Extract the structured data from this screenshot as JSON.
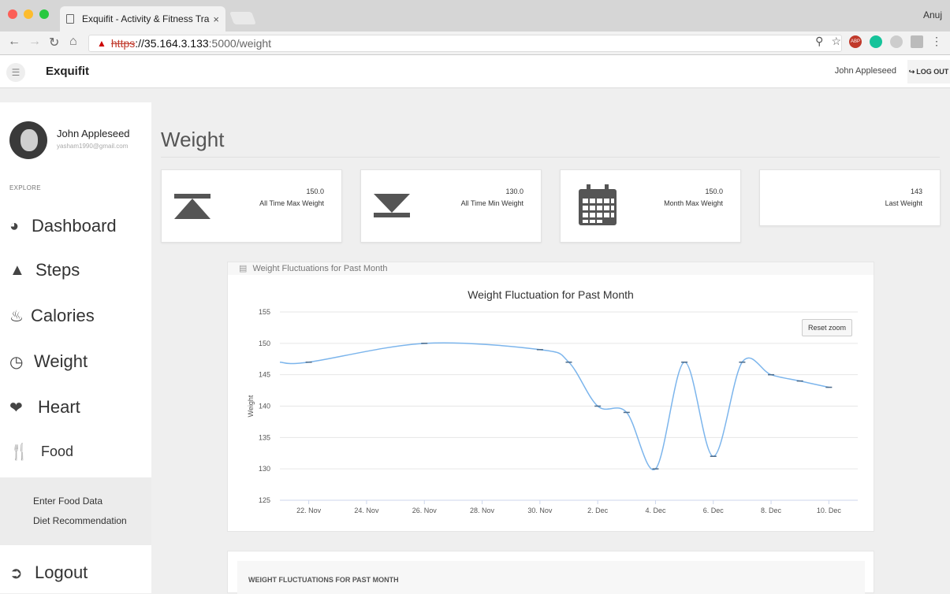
{
  "browser": {
    "tab_title": "Exquifit - Activity & Fitness Tra",
    "tab_close": "×",
    "profile": "Anuj",
    "url_proto": "https",
    "url_host": "://35.164.3.133",
    "url_path": ":5000/weight",
    "ext_abp": "ABP"
  },
  "appbar": {
    "brand": "Exquifit",
    "user": "John Appleseed",
    "logout": "LOG OUT"
  },
  "sidebar": {
    "name": "John Appleseed",
    "email": "yasham1990@gmail.com",
    "section": "EXPLORE",
    "items": [
      {
        "label": "Dashboard",
        "icon": "gauge-icon"
      },
      {
        "label": "Steps",
        "icon": "road-icon"
      },
      {
        "label": "Calories",
        "icon": "flame-icon"
      },
      {
        "label": "Weight",
        "icon": "scale-icon"
      },
      {
        "label": "Heart",
        "icon": "heart-icon"
      },
      {
        "label": "Food",
        "icon": "utensils-icon"
      }
    ],
    "submenu": [
      "Enter Food Data",
      "Diet Recommendation"
    ],
    "logout": "Logout"
  },
  "page": {
    "title": "Weight",
    "stats": [
      {
        "value": "150.0",
        "label": "All Time Max Weight",
        "icon": "arrow-up-max-icon"
      },
      {
        "value": "130.0",
        "label": "All Time Min Weight",
        "icon": "arrow-down-min-icon"
      },
      {
        "value": "150.0",
        "label": "Month Max Weight",
        "icon": "calendar-icon"
      },
      {
        "value": "143",
        "label": "Last Weight",
        "icon": ""
      }
    ],
    "panel_title": "Weight Fluctuations for Past Month",
    "reset_zoom": "Reset zoom",
    "table_title": "WEIGHT FLUCTUATIONS FOR PAST MONTH"
  },
  "chart_data": {
    "type": "line",
    "title": "Weight Fluctuation for Past Month",
    "xlabel": "",
    "ylabel": "Weight",
    "ylim": [
      125,
      155
    ],
    "yticks": [
      125,
      130,
      135,
      140,
      145,
      150,
      155
    ],
    "xticks": [
      "22. Nov",
      "24. Nov",
      "26. Nov",
      "28. Nov",
      "30. Nov",
      "2. Dec",
      "4. Dec",
      "6. Dec",
      "8. Dec",
      "10. Dec"
    ],
    "grid": true,
    "smooth": true,
    "color": "#7cb5ec",
    "points": [
      {
        "x": "2017-11-22",
        "y": 147
      },
      {
        "x": "2017-11-26",
        "y": 150
      },
      {
        "x": "2017-11-30",
        "y": 149
      },
      {
        "x": "2017-12-01",
        "y": 147
      },
      {
        "x": "2017-12-02",
        "y": 140
      },
      {
        "x": "2017-12-03",
        "y": 139
      },
      {
        "x": "2017-12-04",
        "y": 130
      },
      {
        "x": "2017-12-05",
        "y": 147
      },
      {
        "x": "2017-12-06",
        "y": 132
      },
      {
        "x": "2017-12-07",
        "y": 147
      },
      {
        "x": "2017-12-08",
        "y": 145
      },
      {
        "x": "2017-12-09",
        "y": 144
      },
      {
        "x": "2017-12-10",
        "y": 143
      }
    ]
  }
}
